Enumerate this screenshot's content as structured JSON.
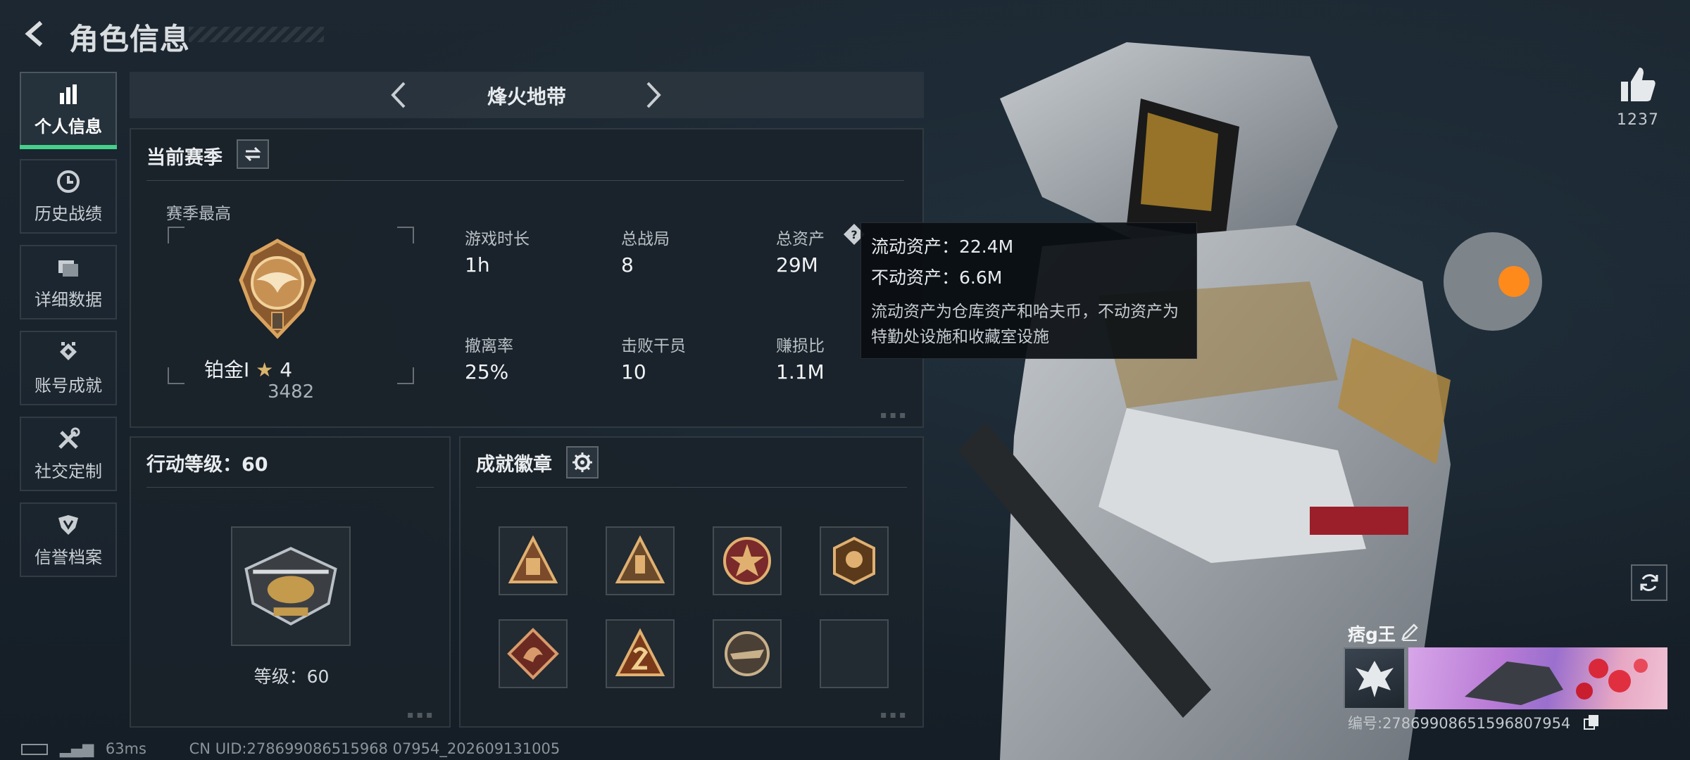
{
  "header": {
    "title": "角色信息"
  },
  "sidebar": {
    "items": [
      {
        "label": "个人信息",
        "icon": "bar-chart-icon",
        "active": true
      },
      {
        "label": "历史战绩",
        "icon": "clock-icon",
        "active": false
      },
      {
        "label": "详细数据",
        "icon": "folder-icon",
        "active": false
      },
      {
        "label": "账号成就",
        "icon": "achievement-icon",
        "active": false
      },
      {
        "label": "社交定制",
        "icon": "tools-icon",
        "active": false
      },
      {
        "label": "信誉档案",
        "icon": "shield-icon",
        "active": false
      }
    ],
    "accent": "#44d08a"
  },
  "mode": {
    "title": "烽火地带"
  },
  "season": {
    "title": "当前赛季",
    "best_label": "赛季最高",
    "rank_name": "铂金I",
    "rank_stars": "4",
    "rank_score": "3482",
    "stats": [
      {
        "label": "游戏时长",
        "value": "1h"
      },
      {
        "label": "总战局",
        "value": "8"
      },
      {
        "label": "总资产",
        "value": "29M"
      },
      {
        "label": "撤离率",
        "value": "25%"
      },
      {
        "label": "击败干员",
        "value": "10"
      },
      {
        "label": "赚损比",
        "value": "1.1M"
      }
    ]
  },
  "tooltip": {
    "liquid": "流动资产：22.4M",
    "fixed": "不动资产：6.6M",
    "desc": "流动资产为仓库资产和哈夫币，不动资产为特勤处设施和收藏室设施"
  },
  "level": {
    "title": "行动等级：60",
    "label": "等级：60"
  },
  "badges": {
    "title": "成就徽章",
    "items": [
      "soldiers-badge-icon",
      "bottle-badge-icon",
      "star-shield-badge-icon",
      "year-2023-badge-icon",
      "dragon-badge-icon",
      "number-two-badge-icon",
      "crocodile-badge-icon",
      "empty-slot"
    ]
  },
  "likes": {
    "count": "1237"
  },
  "player": {
    "name": "痞g王",
    "id_text": "编号:278699086515968079​54"
  },
  "status": {
    "ping": "63ms",
    "uid": "CN UID:278699086515968 07954_202609131005"
  }
}
